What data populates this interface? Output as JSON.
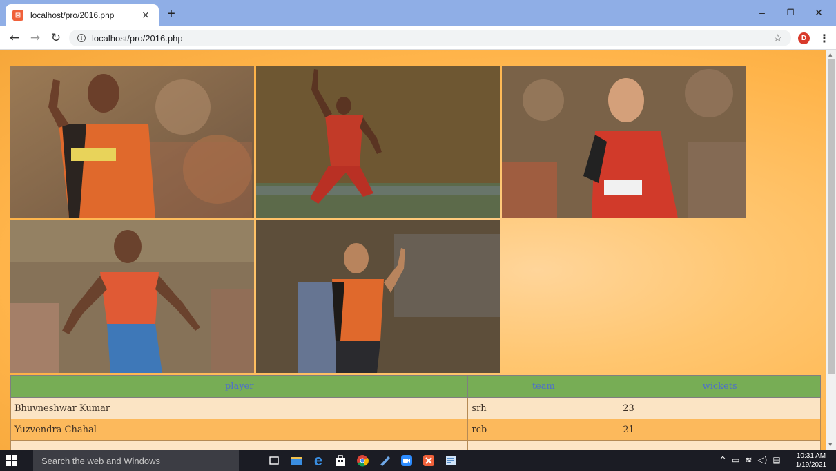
{
  "browser": {
    "tab_title": "localhost/pro/2016.php",
    "tab_close": "×",
    "new_tab": "+",
    "url": "localhost/pro/2016.php",
    "profile_initial": "D",
    "window_minimize": "–",
    "window_restore": "❐",
    "window_close": "✕"
  },
  "players_table": {
    "headers": [
      "player",
      "team",
      "wickets"
    ],
    "rows": [
      {
        "player": "Bhuvneshwar Kumar",
        "team": "srh",
        "wickets": "23"
      },
      {
        "player": "Yuzvendra Chahal",
        "team": "rcb",
        "wickets": "21"
      }
    ]
  },
  "taskbar": {
    "search_placeholder": "Search the web and Windows",
    "time": "10:31 AM",
    "date": "1/19/2021"
  }
}
